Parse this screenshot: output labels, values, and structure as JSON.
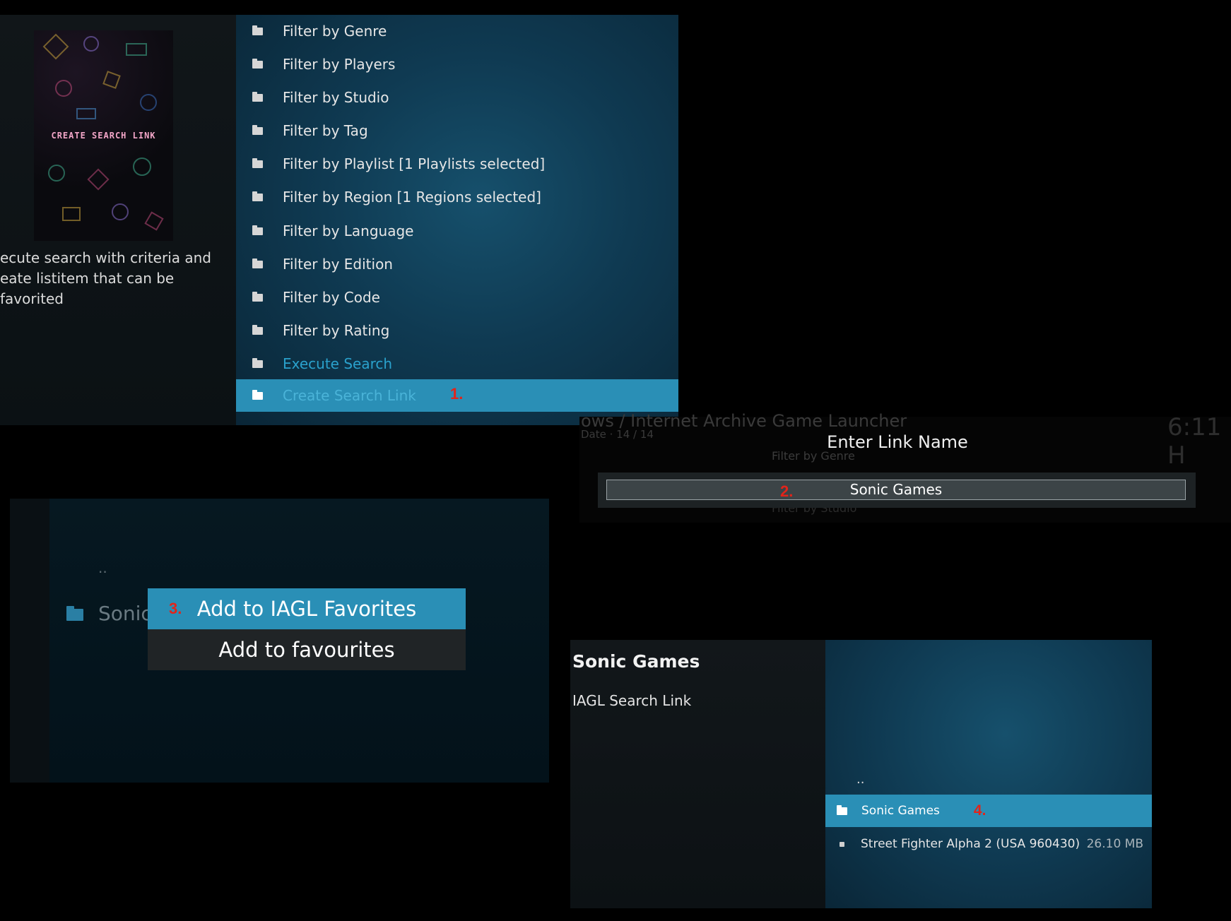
{
  "panel1": {
    "thumbnail_text": "CREATE SEARCH LINK",
    "description_lines": [
      "ecute search with criteria and",
      "eate listitem that can be favorited"
    ],
    "menu_items": [
      {
        "label": "Filter by Genre"
      },
      {
        "label": "Filter by Players"
      },
      {
        "label": "Filter by Studio"
      },
      {
        "label": "Filter by Tag"
      },
      {
        "label": "Filter by Playlist [1 Playlists selected]"
      },
      {
        "label": "Filter by Region [1 Regions selected]"
      },
      {
        "label": "Filter by Language"
      },
      {
        "label": "Filter by Edition"
      },
      {
        "label": "Filter by Code"
      },
      {
        "label": "Filter by Rating"
      },
      {
        "label": "Execute Search"
      },
      {
        "label": "Create Search Link"
      }
    ],
    "marker": "1."
  },
  "panel2": {
    "background_title": "ows / Internet Archive Game Launcher",
    "background_date": "Date  ·  14 / 14",
    "background_clock": "6:11 H",
    "ghost_item_1": "Filter by Genre",
    "ghost_item_2": "Filter by Studio",
    "dialog_title": "Enter Link Name",
    "input_value": "Sonic Games",
    "marker": "2."
  },
  "panel3": {
    "parent_dots": "..",
    "folder_label": "Sonic",
    "menu_item_1": "Add to IAGL Favorites",
    "menu_item_2": "Add to favourites",
    "marker": "3."
  },
  "panel4": {
    "title": "Sonic Games",
    "subtitle": "IAGL Search Link",
    "parent_dots": "..",
    "selected_item": "Sonic Games",
    "game_item": "Street Fighter Alpha 2 (USA 960430)",
    "game_size": "26.10 MB",
    "marker": "4."
  },
  "colors": {
    "highlight": "#2a8fb6",
    "active_text": "#2aa1cc",
    "marker": "#e2241a"
  }
}
